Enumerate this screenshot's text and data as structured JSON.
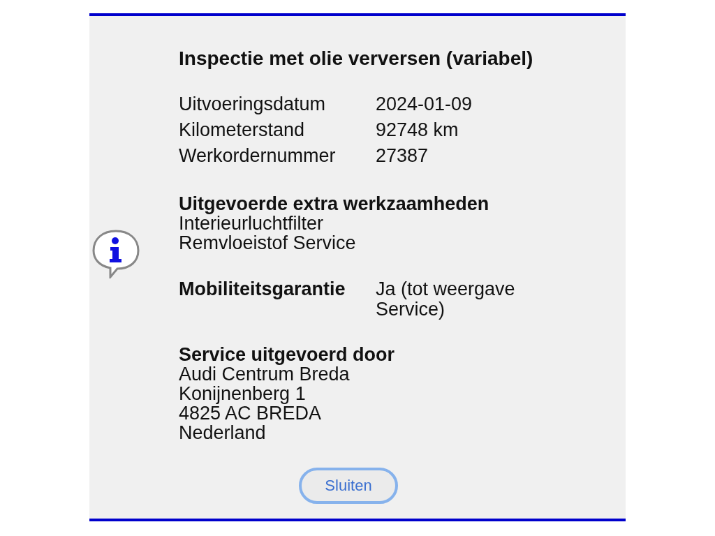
{
  "title": "Inspectie met olie verversen (variabel)",
  "details": [
    {
      "label": "Uitvoeringsdatum",
      "value": "2024-01-09"
    },
    {
      "label": "Kilometerstand",
      "value": "92748 km"
    },
    {
      "label": "Werkordernummer",
      "value": "27387"
    }
  ],
  "extra_work": {
    "heading": "Uitgevoerde extra werkzaamheden",
    "items": [
      "Interieurluchtfilter",
      "Remvloeistof Service"
    ]
  },
  "mobility": {
    "label": "Mobiliteitsgarantie",
    "value": "Ja (tot weergave Service)"
  },
  "serviced_by": {
    "heading": "Service uitgevoerd door",
    "lines": [
      "Audi Centrum Breda",
      "Konijnenberg 1",
      "4825 AC BREDA",
      "Nederland"
    ]
  },
  "close_button": "Sluiten"
}
